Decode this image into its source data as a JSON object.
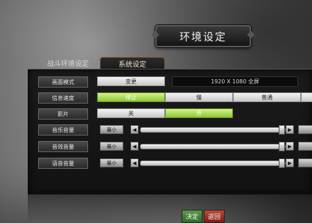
{
  "title": "环境设定",
  "tabs": [
    {
      "label": "战斗环境设定"
    },
    {
      "label": "系统设定",
      "active": true
    }
  ],
  "rows": {
    "display_mode": {
      "label": "画面模式",
      "button": "变更",
      "value": "1920 X 1080 全屏"
    },
    "message_speed": {
      "label": "信息速度",
      "options": [
        "停止",
        "慢",
        "普通"
      ],
      "selected": "停止"
    },
    "movie": {
      "label": "影片",
      "options": [
        "关",
        "开"
      ],
      "selected": "开"
    },
    "music_volume": {
      "label": "音乐音量",
      "min_label": "最小",
      "level": 1.0
    },
    "sfx_volume": {
      "label": "音效音量",
      "min_label": "最小",
      "level": 1.0
    },
    "voice_volume": {
      "label": "语音音量",
      "min_label": "最小",
      "level": 1.0
    }
  },
  "arrows": {
    "left": "◀",
    "right": "▶"
  },
  "footer": {
    "confirm": "决定",
    "back": "返回"
  },
  "colors": {
    "accent_green": "#8cc53a",
    "tab_border": "#8a5a2a",
    "back_red": "#a03a2a"
  }
}
